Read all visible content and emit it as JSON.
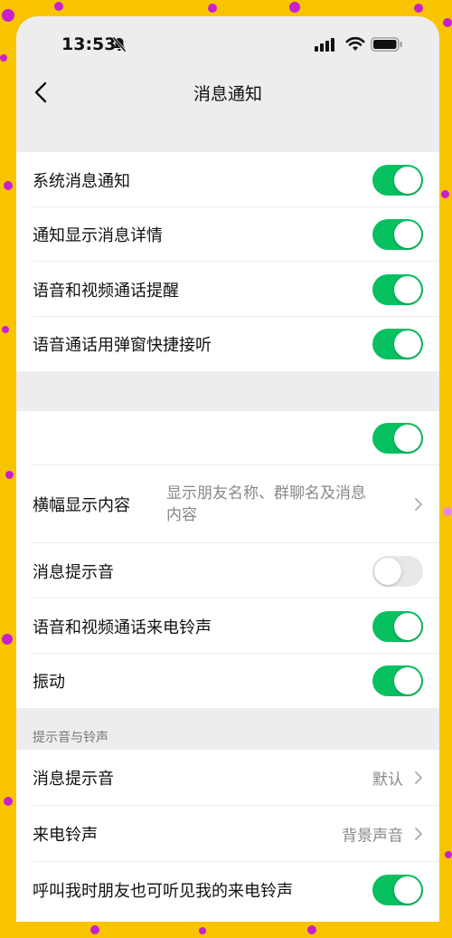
{
  "status": {
    "time": "13:53"
  },
  "nav": {
    "title": "消息通知"
  },
  "group1": [
    {
      "label": "系统消息通知",
      "toggle": "on"
    },
    {
      "label": "通知显示消息详情",
      "toggle": "on"
    },
    {
      "label": "语音和视频通话提醒",
      "toggle": "on"
    },
    {
      "label": "语音通话用弹窗快捷接听",
      "toggle": "on"
    }
  ],
  "group2": {
    "row0": {
      "label": "",
      "toggle": "on"
    },
    "banner": {
      "label": "横幅显示内容",
      "value_line1": "显示朋友名称、群聊名及消息",
      "value_line2": "内容"
    },
    "row2": {
      "label": "消息提示音",
      "toggle": "off"
    },
    "row3": {
      "label": "语音和视频通话来电铃声",
      "toggle": "on"
    },
    "row4": {
      "label": "振动",
      "toggle": "on"
    }
  },
  "section3": {
    "header": "提示音与铃声",
    "message_tone": {
      "label": "消息提示音",
      "value": "默认"
    },
    "ringtone": {
      "label": "来电铃声",
      "value": "背景声音"
    },
    "friends_hear": {
      "label": "呼叫我时朋友也可听见我的来电铃声",
      "toggle": "on"
    }
  },
  "colors": {
    "accent": "#07c160",
    "background": "#ededed",
    "frame": "#f8c400",
    "dots": "#c81fd0"
  }
}
